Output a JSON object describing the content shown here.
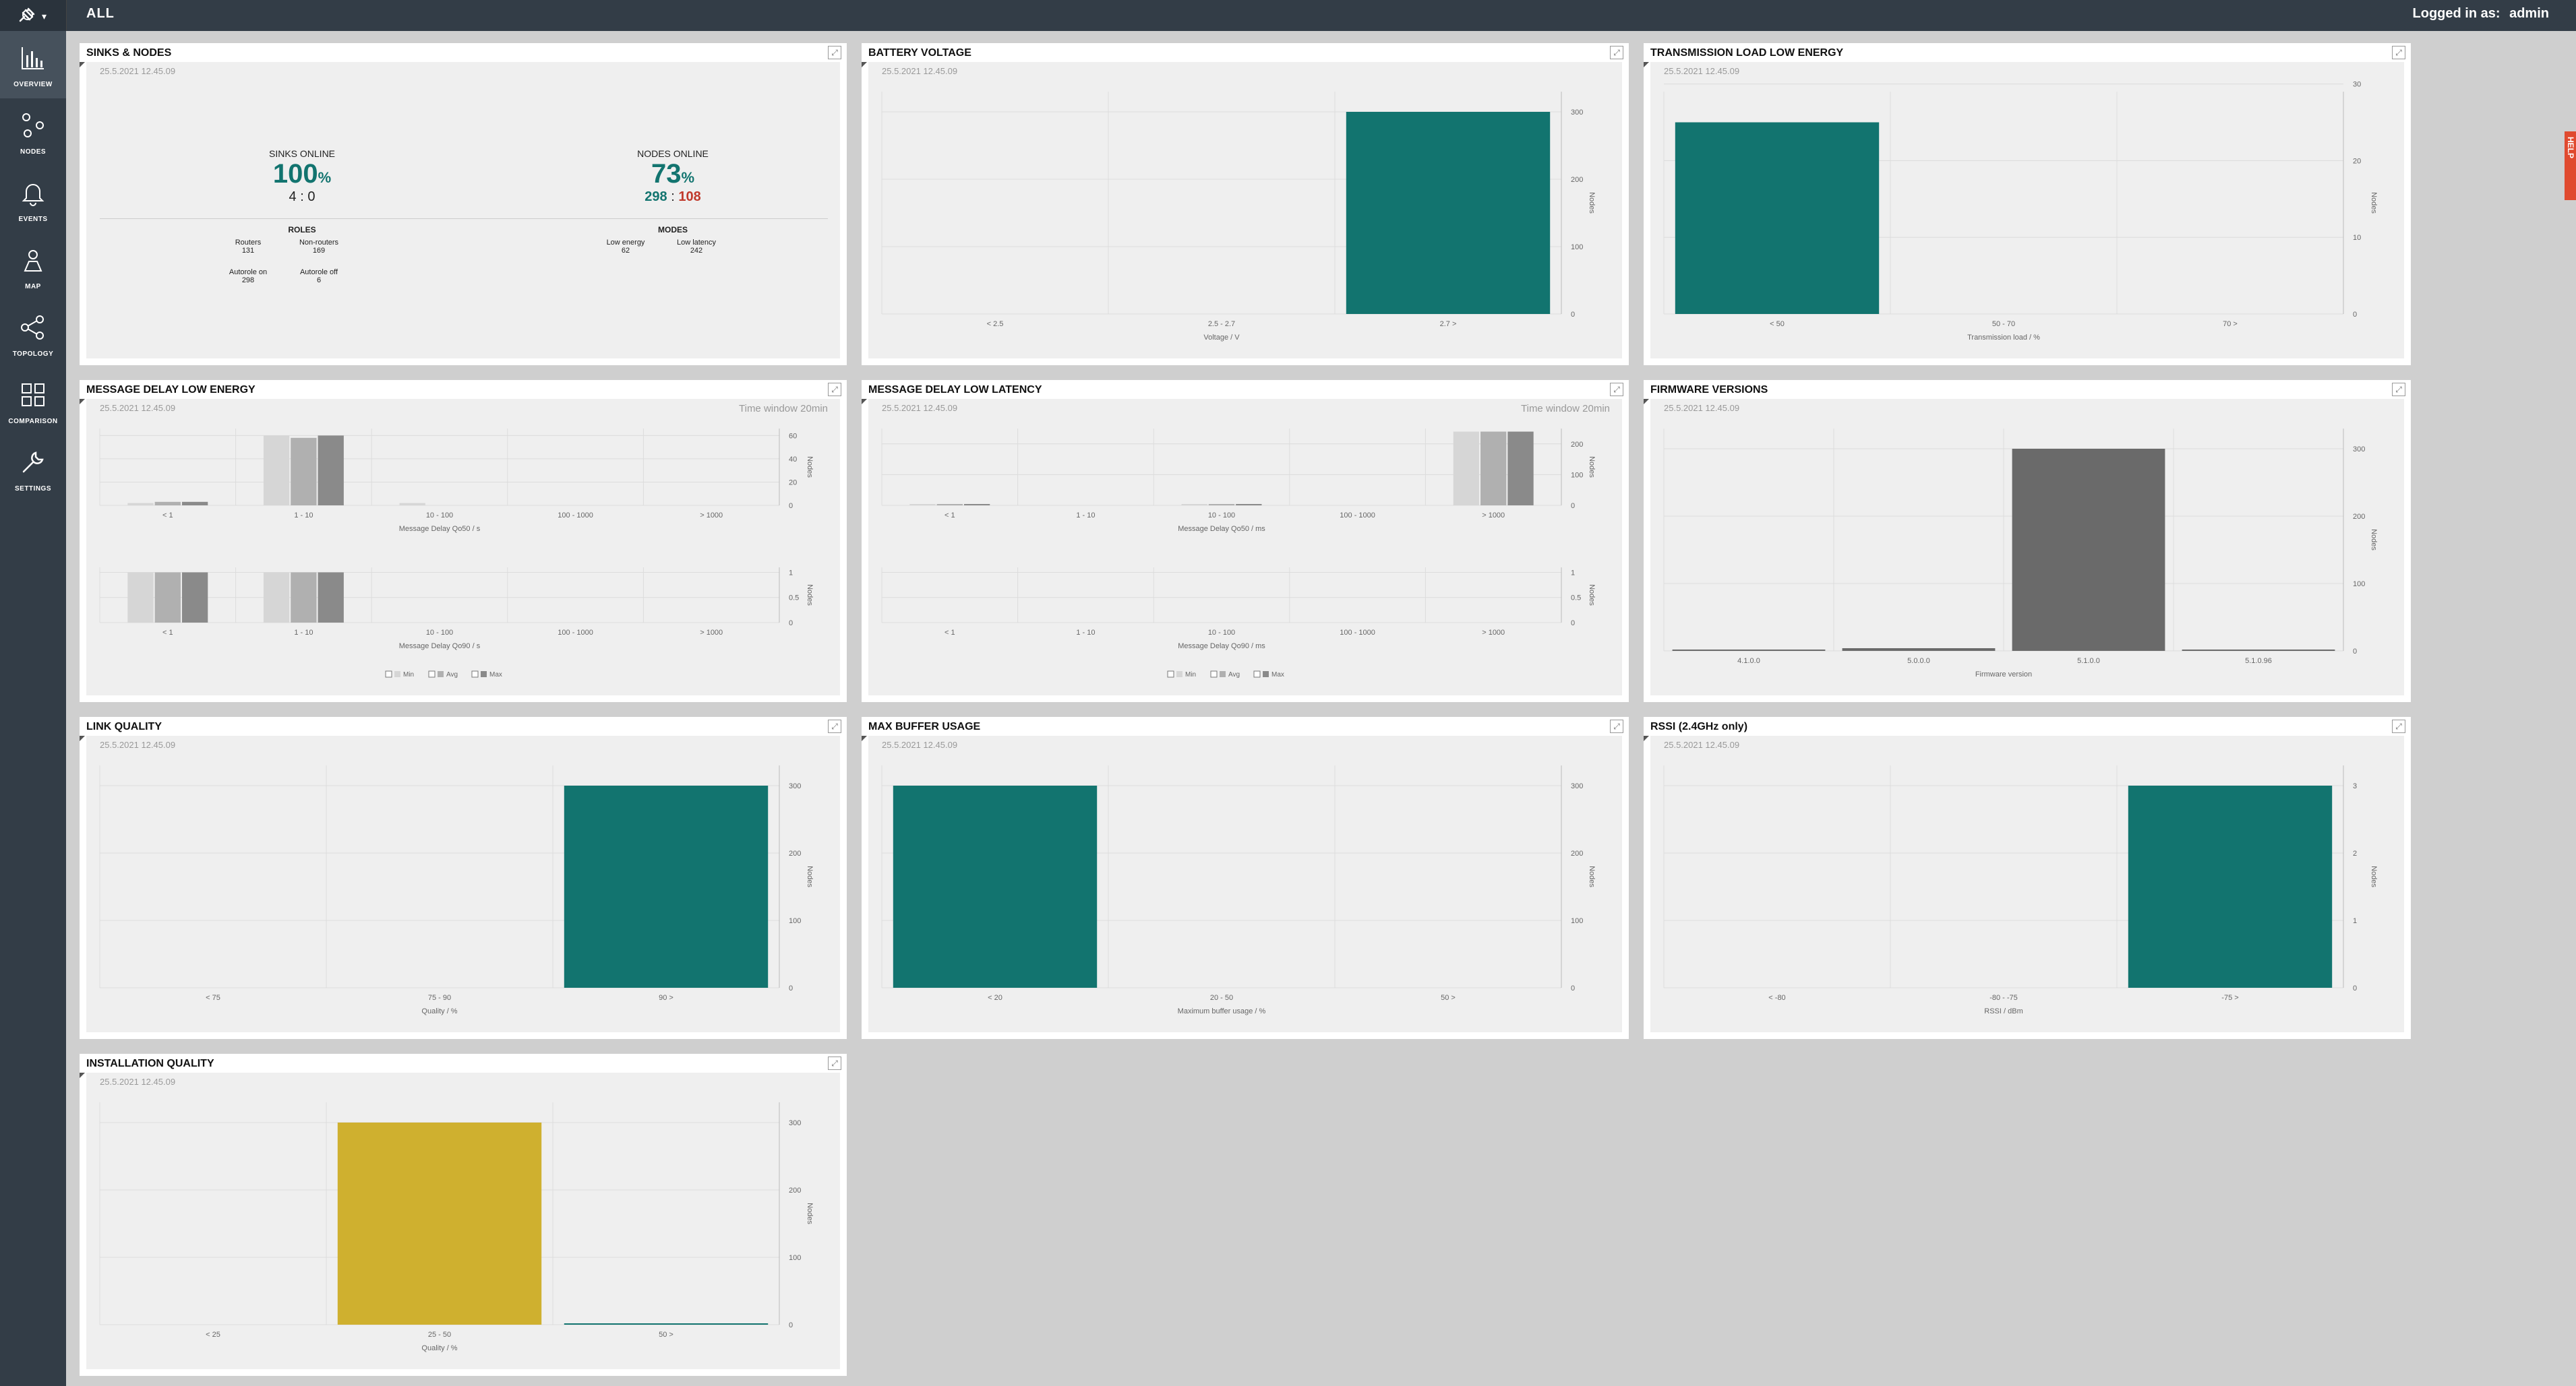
{
  "app": {
    "breadcrumb": "ALL",
    "login_label": "Logged in as:",
    "login_user": "admin",
    "help": "HELP"
  },
  "nav": [
    {
      "id": "overview",
      "label": "OVERVIEW",
      "icon": "bar-chart-icon"
    },
    {
      "id": "nodes",
      "label": "NODES",
      "icon": "nodes-icon"
    },
    {
      "id": "events",
      "label": "EVENTS",
      "icon": "bell-icon"
    },
    {
      "id": "map",
      "label": "MAP",
      "icon": "map-icon"
    },
    {
      "id": "topology",
      "label": "TOPOLOGY",
      "icon": "topology-icon"
    },
    {
      "id": "comparison",
      "label": "COMPARISON",
      "icon": "grid-icon"
    },
    {
      "id": "settings",
      "label": "SETTINGS",
      "icon": "wrench-icon"
    }
  ],
  "timestamp": "25.5.2021 12.45.09",
  "sinks_nodes": {
    "title": "SINKS & NODES",
    "sinks_label": "SINKS ONLINE",
    "sinks_pct": "100",
    "pct_sign": "%",
    "sinks_online": "4",
    "sinks_offline": "0",
    "sep": ":",
    "nodes_label": "NODES ONLINE",
    "nodes_pct": "73",
    "nodes_online": "298",
    "nodes_offline": "108",
    "roles_label": "ROLES",
    "routers_label": "Routers",
    "routers": "131",
    "nonrouters_label": "Non-routers",
    "nonrouters": "169",
    "autorole_on_label": "Autorole on",
    "autorole_on": "298",
    "autorole_off_label": "Autorole off",
    "autorole_off": "6",
    "modes_label": "MODES",
    "low_energy_label": "Low energy",
    "low_energy": "62",
    "low_latency_label": "Low latency",
    "low_latency": "242"
  },
  "colors": {
    "teal": "#12746f",
    "gold": "#cfb02f",
    "gray_dark": "#6a6a6a",
    "red": "#c0392b"
  },
  "chart_data": [
    {
      "id": "battery",
      "title": "BATTERY VOLTAGE",
      "type": "bar",
      "categories": [
        "< 2.5",
        "2.5 - 2.7",
        "2.7 >"
      ],
      "values": [
        0,
        0,
        300
      ],
      "xlabel": "Voltage / V",
      "ylabel": "Nodes",
      "yticks": [
        0,
        100,
        200,
        300
      ],
      "ylim": [
        0,
        330
      ],
      "color": "#12746f"
    },
    {
      "id": "txload",
      "title": "TRANSMISSION LOAD LOW ENERGY",
      "type": "bar",
      "categories": [
        "< 50",
        "50 - 70",
        "70 >"
      ],
      "values": [
        25,
        0,
        0
      ],
      "xlabel": "Transmission load / %",
      "ylabel": "Nodes",
      "yticks": [
        0,
        10,
        20,
        30
      ],
      "ylim": [
        0,
        29
      ],
      "color": "#12746f"
    },
    {
      "id": "delay_le",
      "title": "MESSAGE DELAY LOW ENERGY",
      "time_window": "Time window 20min",
      "type": "bar",
      "legend": [
        "Min",
        "Avg",
        "Max"
      ],
      "top": {
        "categories": [
          "< 1",
          "1 - 10",
          "10 - 100",
          "100 - 1000",
          "> 1000"
        ],
        "xlabel": "Message Delay Qo50 / s",
        "ylabel": "Nodes",
        "yticks": [
          0,
          20,
          40,
          60
        ],
        "ylim": [
          0,
          66
        ],
        "series": [
          {
            "name": "Min",
            "values": [
              2,
              60,
              2,
              0,
              0
            ]
          },
          {
            "name": "Avg",
            "values": [
              3,
              58,
              0,
              0,
              0
            ]
          },
          {
            "name": "Max",
            "values": [
              3,
              60,
              0,
              0,
              0
            ]
          }
        ]
      },
      "bottom": {
        "categories": [
          "< 1",
          "1 - 10",
          "10 - 100",
          "100 - 1000",
          "> 1000"
        ],
        "xlabel": "Message Delay Qo90 / s",
        "ylabel": "Nodes",
        "yticks": [
          0,
          0.5,
          1
        ],
        "ylim": [
          0,
          1.1
        ],
        "series": [
          {
            "name": "Min",
            "values": [
              1,
              1,
              0,
              0,
              0
            ]
          },
          {
            "name": "Avg",
            "values": [
              1,
              1,
              0,
              0,
              0
            ]
          },
          {
            "name": "Max",
            "values": [
              1,
              1,
              0,
              0,
              0
            ]
          }
        ]
      }
    },
    {
      "id": "delay_ll",
      "title": "MESSAGE DELAY LOW LATENCY",
      "time_window": "Time window 20min",
      "type": "bar",
      "legend": [
        "Min",
        "Avg",
        "Max"
      ],
      "top": {
        "categories": [
          "< 1",
          "1 - 10",
          "10 - 100",
          "100 - 1000",
          "> 1000"
        ],
        "xlabel": "Message Delay Qo50 / ms",
        "ylabel": "Nodes",
        "yticks": [
          0,
          100,
          200
        ],
        "ylim": [
          0,
          250
        ],
        "series": [
          {
            "name": "Min",
            "values": [
              1,
              0,
              1,
              0,
              240
            ]
          },
          {
            "name": "Avg",
            "values": [
              1,
              0,
              1,
              0,
              240
            ]
          },
          {
            "name": "Max",
            "values": [
              1,
              0,
              1,
              0,
              240
            ]
          }
        ]
      },
      "bottom": {
        "categories": [
          "< 1",
          "1 - 10",
          "10 - 100",
          "100 - 1000",
          "> 1000"
        ],
        "xlabel": "Message Delay Qo90 / ms",
        "ylabel": "Nodes",
        "yticks": [
          0,
          0.5,
          1
        ],
        "ylim": [
          0,
          1.1
        ],
        "series": [
          {
            "name": "Min",
            "values": [
              0,
              0,
              0,
              0,
              0
            ]
          },
          {
            "name": "Avg",
            "values": [
              0,
              0,
              0,
              0,
              0
            ]
          },
          {
            "name": "Max",
            "values": [
              0,
              0,
              0,
              0,
              0
            ]
          }
        ]
      }
    },
    {
      "id": "firmware",
      "title": "FIRMWARE VERSIONS",
      "type": "bar",
      "categories": [
        "4.1.0.0",
        "5.0.0.0",
        "5.1.0.0",
        "5.1.0.96"
      ],
      "values": [
        2,
        4,
        300,
        1
      ],
      "xlabel": "Firmware version",
      "ylabel": "Nodes",
      "yticks": [
        0,
        100,
        200,
        300
      ],
      "ylim": [
        0,
        330
      ],
      "color": "#6a6a6a"
    },
    {
      "id": "link",
      "title": "LINK QUALITY",
      "type": "bar",
      "categories": [
        "< 75",
        "75 - 90",
        "90 >"
      ],
      "values": [
        0,
        0,
        300
      ],
      "xlabel": "Quality / %",
      "ylabel": "Nodes",
      "yticks": [
        0,
        100,
        200,
        300
      ],
      "ylim": [
        0,
        330
      ],
      "color": "#12746f"
    },
    {
      "id": "buffer",
      "title": "MAX BUFFER USAGE",
      "type": "bar",
      "categories": [
        "< 20",
        "20 - 50",
        "50 >"
      ],
      "values": [
        300,
        0,
        0
      ],
      "xlabel": "Maximum buffer usage / %",
      "ylabel": "Nodes",
      "yticks": [
        0,
        100,
        200,
        300
      ],
      "ylim": [
        0,
        330
      ],
      "color": "#12746f"
    },
    {
      "id": "rssi",
      "title": "RSSI (2.4GHz only)",
      "type": "bar",
      "categories": [
        "< -80",
        "-80 - -75",
        "-75 >"
      ],
      "values": [
        0,
        0,
        3
      ],
      "xlabel": "RSSI / dBm",
      "ylabel": "Nodes",
      "yticks": [
        0,
        1,
        2,
        3
      ],
      "ylim": [
        0,
        3.3
      ],
      "color": "#12746f"
    },
    {
      "id": "install",
      "title": "INSTALLATION QUALITY",
      "type": "bar",
      "categories": [
        "< 25",
        "25 - 50",
        "50 >"
      ],
      "values": [
        0,
        300,
        1
      ],
      "xlabel": "Quality / %",
      "ylabel": "Nodes",
      "yticks": [
        0,
        100,
        200,
        300
      ],
      "ylim": [
        0,
        330
      ],
      "color": "#cfb02f",
      "colors": [
        "#cfb02f",
        "#cfb02f",
        "#12746f"
      ]
    }
  ]
}
